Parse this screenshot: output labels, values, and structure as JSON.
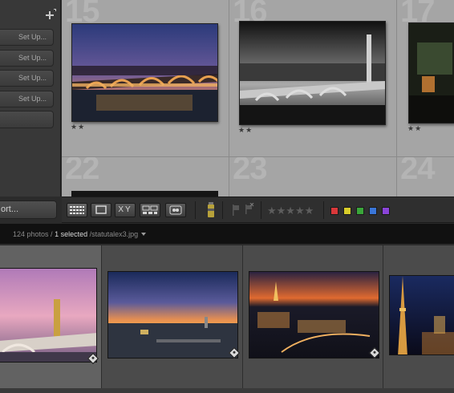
{
  "left_panel": {
    "add_icon": "plus-icon",
    "setup_buttons": [
      "Set Up...",
      "Set Up...",
      "Set Up...",
      "Set Up..."
    ],
    "import_label": "ort..."
  },
  "grid": {
    "cells": [
      {
        "number": "15",
        "stars": "★★",
        "thumb": "paris-bridge-dusk"
      },
      {
        "number": "16",
        "stars": "★★",
        "thumb": "paris-bridge-bw"
      },
      {
        "number": "17",
        "stars": "★★",
        "thumb": "dark-house"
      },
      {
        "number": "22"
      },
      {
        "number": "23"
      },
      {
        "number": "24"
      }
    ]
  },
  "toolbar": {
    "view_modes": [
      "grid-view-icon",
      "loupe-view-icon",
      "compare-view-icon",
      "survey-view-icon",
      "people-view-icon"
    ],
    "compare_label": "XY",
    "painter_icon": "spray-can-icon",
    "flag_icons": [
      "flag-icon",
      "reject-flag-icon"
    ],
    "star_rating": "★★★★★",
    "color_labels": [
      "#d9383a",
      "#d8cd2a",
      "#3aa63a",
      "#3a76d8",
      "#8a44d8"
    ]
  },
  "filmstrip": {
    "count_text": "124 photos /",
    "selected_text": "1 selected",
    "filename": "/statutalex3.jpg",
    "dropdown_icon": "caret-down-icon",
    "items": [
      {
        "thumb": "alexandre-iii-bridge",
        "badge": "tag-icon"
      },
      {
        "thumb": "paris-skyline-sunset",
        "badge": "tag-icon"
      },
      {
        "thumb": "paris-night-eiffel",
        "badge": "tag-icon"
      },
      {
        "thumb": "eiffel-tower-night",
        "badge": ""
      }
    ]
  }
}
